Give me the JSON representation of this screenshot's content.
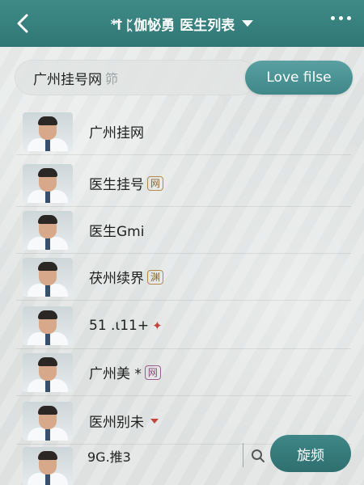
{
  "header": {
    "glyph": "*†",
    "title_prefix": "ᛈ伽怭勇",
    "title": "医生列表"
  },
  "search": {
    "value": "广州挂号网",
    "hint": "笷",
    "button_label": "Love filse"
  },
  "doctors": [
    {
      "name": "广州挂网",
      "tag": ""
    },
    {
      "name": "医生挂号",
      "tag": "网"
    },
    {
      "name": "医生Gmi",
      "tag": ""
    },
    {
      "name": "茯州续界",
      "tag": "渊"
    },
    {
      "name": "51 .ι11+",
      "tag": ""
    },
    {
      "name": "广州美 *",
      "tag": "网"
    },
    {
      "name": "医州别未",
      "tag": ""
    }
  ],
  "bottom": {
    "input_value": "9G.推3",
    "button_label": "旋频"
  },
  "colors": {
    "header": "#2f7775",
    "accent": "#3f8788",
    "tag_border": "#b38a4a",
    "mark_red": "#c4443e"
  }
}
